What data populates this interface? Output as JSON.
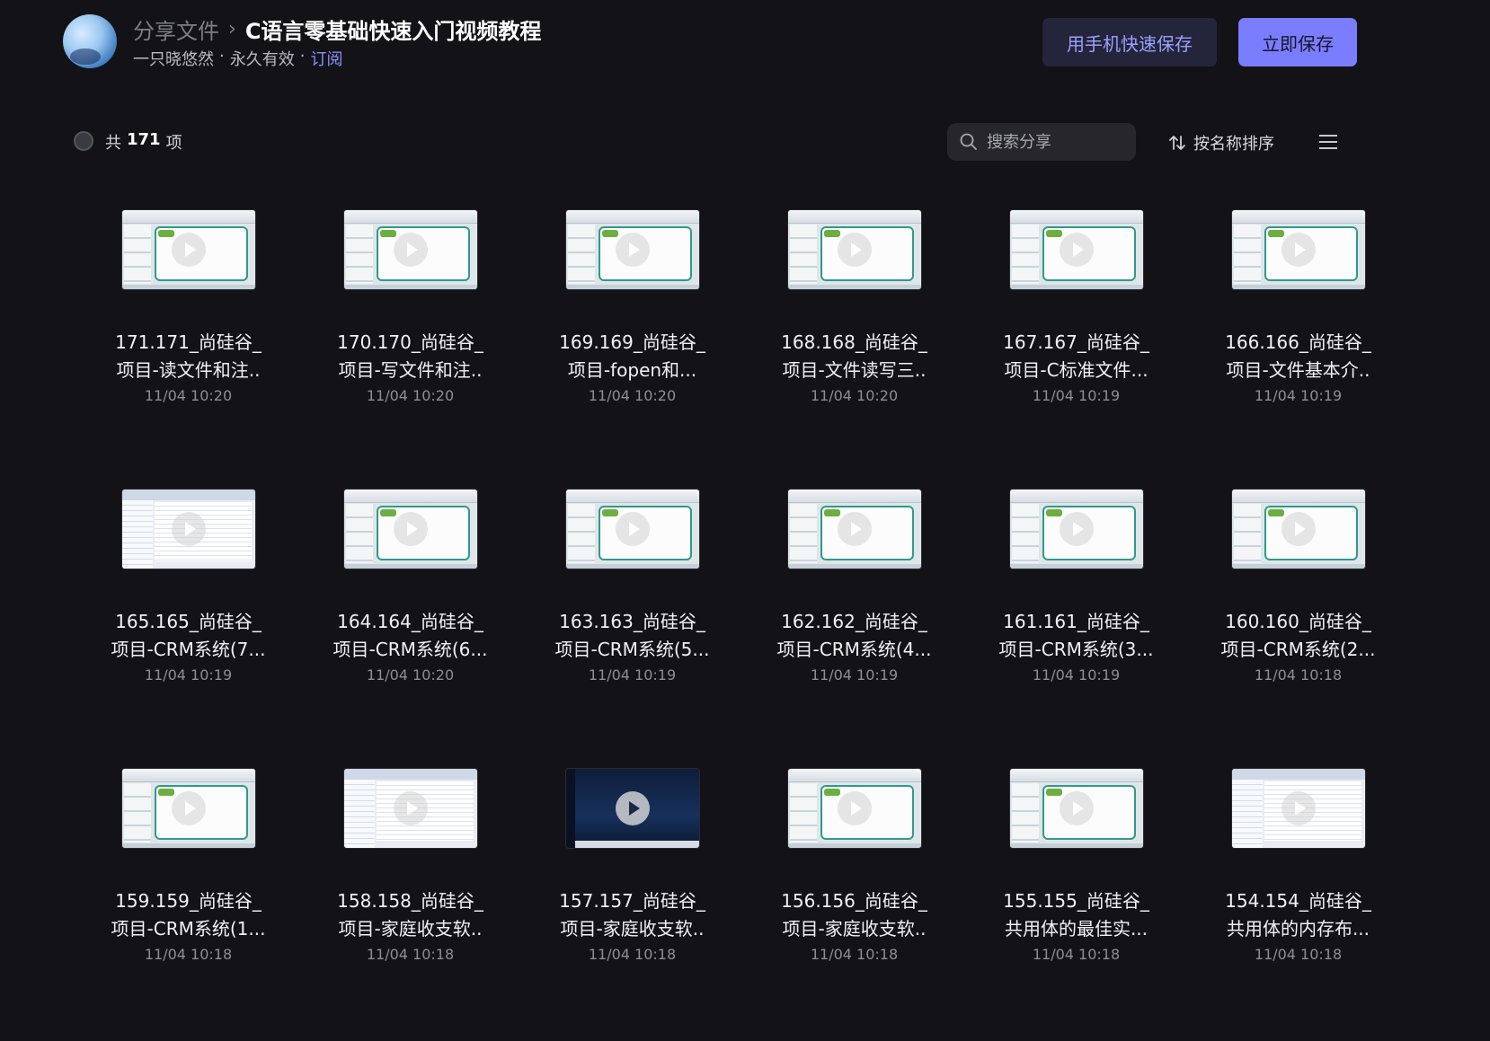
{
  "header": {
    "breadcrumb_parent": "分享文件",
    "breadcrumb_sep": "›",
    "title": "C语言零基础快速入门视频教程",
    "owner": "一只晓悠然",
    "validity": "永久有效",
    "subscribe": "订阅",
    "dot": "·",
    "btn_phone": "用手机快速保存",
    "btn_save": "立即保存"
  },
  "toolbar": {
    "count_prefix": "共",
    "count_value": "171",
    "count_suffix": "项",
    "search_placeholder": "搜索分享",
    "sort_label": "按名称排序"
  },
  "files": [
    {
      "line1": "171.171_尚硅谷_",
      "line2": "项目-读文件和注..",
      "date": "11/04 10:20",
      "thumb": "ppt"
    },
    {
      "line1": "170.170_尚硅谷_",
      "line2": "项目-写文件和注..",
      "date": "11/04 10:20",
      "thumb": "ppt"
    },
    {
      "line1": "169.169_尚硅谷_",
      "line2": "项目-fopen和...",
      "date": "11/04 10:20",
      "thumb": "ppt"
    },
    {
      "line1": "168.168_尚硅谷_",
      "line2": "项目-文件读写三..",
      "date": "11/04 10:20",
      "thumb": "ppt"
    },
    {
      "line1": "167.167_尚硅谷_",
      "line2": "项目-C标准文件...",
      "date": "11/04 10:19",
      "thumb": "ppt"
    },
    {
      "line1": "166.166_尚硅谷_",
      "line2": "项目-文件基本介..",
      "date": "11/04 10:19",
      "thumb": "ppt"
    },
    {
      "line1": "165.165_尚硅谷_",
      "line2": "项目-CRM系统(7...",
      "date": "11/04 10:19",
      "thumb": "code"
    },
    {
      "line1": "164.164_尚硅谷_",
      "line2": "项目-CRM系统(6...",
      "date": "11/04 10:20",
      "thumb": "ppt"
    },
    {
      "line1": "163.163_尚硅谷_",
      "line2": "项目-CRM系统(5...",
      "date": "11/04 10:19",
      "thumb": "ppt"
    },
    {
      "line1": "162.162_尚硅谷_",
      "line2": "项目-CRM系统(4...",
      "date": "11/04 10:19",
      "thumb": "ppt"
    },
    {
      "line1": "161.161_尚硅谷_",
      "line2": "项目-CRM系统(3...",
      "date": "11/04 10:19",
      "thumb": "ppt"
    },
    {
      "line1": "160.160_尚硅谷_",
      "line2": "项目-CRM系统(2...",
      "date": "11/04 10:18",
      "thumb": "ppt"
    },
    {
      "line1": "159.159_尚硅谷_",
      "line2": "项目-CRM系统(1...",
      "date": "11/04 10:18",
      "thumb": "ppt"
    },
    {
      "line1": "158.158_尚硅谷_",
      "line2": "项目-家庭收支软..",
      "date": "11/04 10:18",
      "thumb": "code"
    },
    {
      "line1": "157.157_尚硅谷_",
      "line2": "项目-家庭收支软..",
      "date": "11/04 10:18",
      "thumb": "dark"
    },
    {
      "line1": "156.156_尚硅谷_",
      "line2": "项目-家庭收支软..",
      "date": "11/04 10:18",
      "thumb": "ppt"
    },
    {
      "line1": "155.155_尚硅谷_",
      "line2": "共用体的最佳实...",
      "date": "11/04 10:18",
      "thumb": "ppt"
    },
    {
      "line1": "154.154_尚硅谷_",
      "line2": "共用体的内存布...",
      "date": "11/04 10:18",
      "thumb": "code"
    }
  ]
}
